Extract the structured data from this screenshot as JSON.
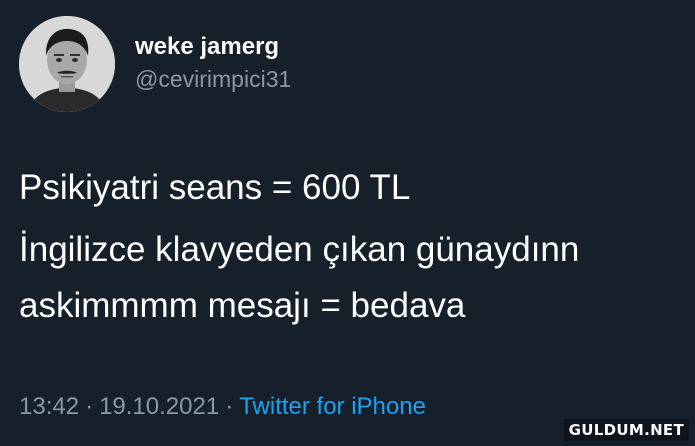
{
  "tweet": {
    "display_name": "weke jamerg",
    "handle": "@cevirimpici31",
    "lines": [
      "Psikiyatri seans = 600 TL",
      "İngilizce klavyeden çıkan günaydınn askimmmm mesajı = bedava"
    ],
    "line2_part1": "İngilizce klavyeden çıkan günaydınn",
    "line2_part2": "askimmmm mesajı = bedava",
    "time": "13:42",
    "date": "19.10.2021",
    "separator": "·",
    "source": "Twitter for iPhone"
  },
  "watermark": "GULDUM.NET",
  "colors": {
    "background": "#15202b",
    "text": "#ffffff",
    "secondary_text": "#8899a6",
    "link": "#1da1f2"
  },
  "icons": {
    "avatar": "profile-photo"
  }
}
